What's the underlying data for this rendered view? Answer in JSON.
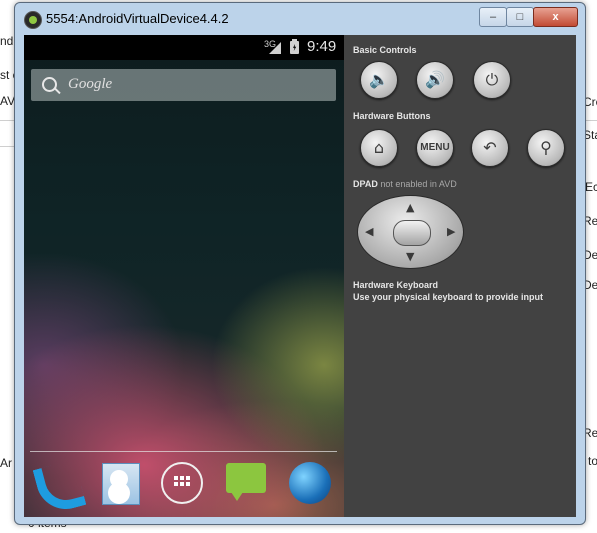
{
  "background_app": {
    "left_fragments": [
      "Andro",
      "ndro",
      "st c",
      "AVD",
      "Ar"
    ],
    "right_fragments": [
      "Cre",
      "Sta",
      "Ec",
      "Rep",
      "Del",
      "Det",
      "Ref",
      "to"
    ],
    "bottom_fragment": "0 items"
  },
  "window": {
    "title": "5554:AndroidVirtualDevice4.4.2",
    "minimize_label": "–",
    "maximize_label": "□",
    "close_label": "x"
  },
  "device": {
    "status_bar": {
      "network": "3G",
      "time": "9:49"
    },
    "search": {
      "placeholder": "Google"
    },
    "dock_icons": [
      "phone-icon",
      "contacts-icon",
      "apps-icon",
      "messaging-icon",
      "browser-icon"
    ]
  },
  "controls": {
    "basic_controls": {
      "label": "Basic Controls",
      "buttons": [
        "volume-down-icon",
        "volume-up-icon",
        "power-icon"
      ]
    },
    "hardware_buttons": {
      "label": "Hardware Buttons",
      "menu_label": "MENU",
      "buttons": [
        "home-icon",
        "menu-button",
        "back-icon",
        "search-icon"
      ]
    },
    "dpad": {
      "label": "DPAD",
      "status": "not enabled in AVD"
    },
    "hardware_keyboard": {
      "label": "Hardware Keyboard",
      "hint": "Use your physical keyboard to provide input"
    }
  },
  "colors": {
    "panel_background": "#424242",
    "title_bar": "#bcd3ea",
    "close_button": "#c24b33"
  }
}
